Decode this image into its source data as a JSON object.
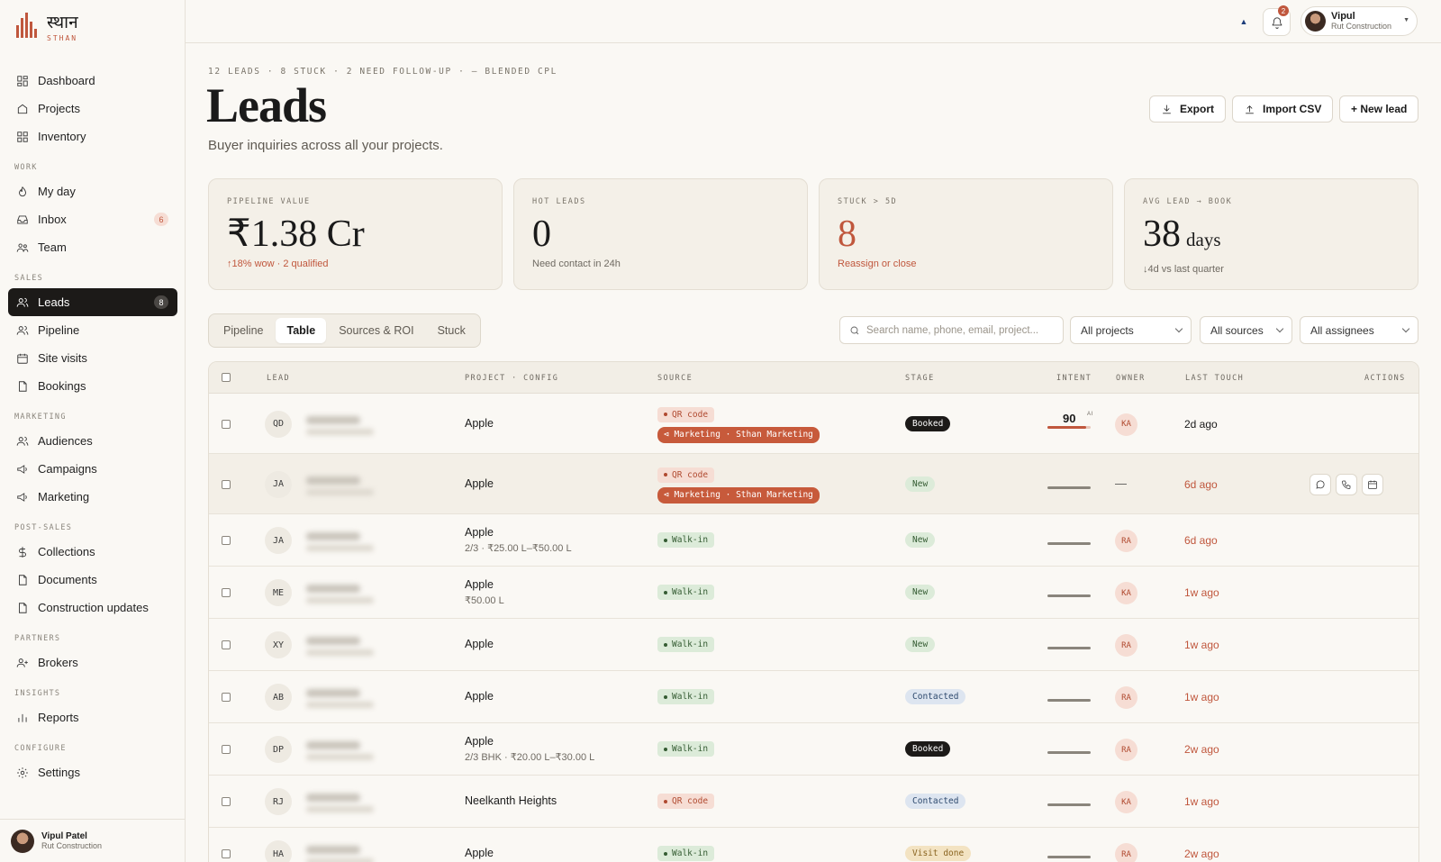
{
  "brand": {
    "name": "स्थान",
    "sub": "STHAN"
  },
  "nav": {
    "top": [
      {
        "id": "dashboard",
        "label": "Dashboard",
        "icon": "dashboard-icon"
      },
      {
        "id": "projects",
        "label": "Projects",
        "icon": "home-icon"
      },
      {
        "id": "inventory",
        "label": "Inventory",
        "icon": "grid-icon"
      }
    ],
    "sections": [
      {
        "title": "WORK",
        "items": [
          {
            "id": "my-day",
            "label": "My day",
            "icon": "flame-icon"
          },
          {
            "id": "inbox",
            "label": "Inbox",
            "icon": "inbox-icon",
            "badge": "6"
          },
          {
            "id": "team",
            "label": "Team",
            "icon": "team-icon"
          }
        ]
      },
      {
        "title": "SALES",
        "items": [
          {
            "id": "leads",
            "label": "Leads",
            "icon": "users-icon",
            "badge": "8",
            "active": true
          },
          {
            "id": "pipeline",
            "label": "Pipeline",
            "icon": "users-icon"
          },
          {
            "id": "site-visits",
            "label": "Site visits",
            "icon": "calendar-icon"
          },
          {
            "id": "bookings",
            "label": "Bookings",
            "icon": "document-icon"
          }
        ]
      },
      {
        "title": "MARKETING",
        "items": [
          {
            "id": "audiences",
            "label": "Audiences",
            "icon": "users-icon"
          },
          {
            "id": "campaigns",
            "label": "Campaigns",
            "icon": "megaphone-icon"
          },
          {
            "id": "marketing",
            "label": "Marketing",
            "icon": "megaphone-icon"
          }
        ]
      },
      {
        "title": "POST-SALES",
        "items": [
          {
            "id": "collections",
            "label": "Collections",
            "icon": "dollar-icon"
          },
          {
            "id": "documents",
            "label": "Documents",
            "icon": "document-icon"
          },
          {
            "id": "construction-updates",
            "label": "Construction updates",
            "icon": "document-icon"
          }
        ]
      },
      {
        "title": "PARTNERS",
        "items": [
          {
            "id": "brokers",
            "label": "Brokers",
            "icon": "user-plus-icon"
          }
        ]
      },
      {
        "title": "INSIGHTS",
        "items": [
          {
            "id": "reports",
            "label": "Reports",
            "icon": "bar-chart-icon"
          }
        ]
      },
      {
        "title": "CONFIGURE",
        "items": [
          {
            "id": "settings",
            "label": "Settings",
            "icon": "gear-icon"
          }
        ]
      }
    ]
  },
  "sidebar_user": {
    "name": "Vipul Patel",
    "org": "Rut Construction"
  },
  "topbar": {
    "notifications": "2",
    "user_name": "Vipul",
    "user_org": "Rut Construction"
  },
  "page": {
    "meta": "12 LEADS · 8 STUCK · 2 NEED FOLLOW-UP · — BLENDED CPL",
    "title": "Leads",
    "subtitle": "Buyer inquiries across all your projects.",
    "buttons": {
      "export": "Export",
      "import": "Import CSV",
      "new": "+ New lead"
    }
  },
  "kpis": [
    {
      "label": "PIPELINE VALUE",
      "value": "₹1.38 Cr",
      "unit": "",
      "note": "↑18% wow · 2 qualified",
      "value_red": false,
      "note_red": true
    },
    {
      "label": "HOT LEADS",
      "value": "0",
      "unit": "",
      "note": "Need contact in 24h",
      "value_red": false,
      "note_red": false
    },
    {
      "label": "STUCK > 5D",
      "value": "8",
      "unit": "",
      "note": "Reassign or close",
      "value_red": true,
      "note_red": true
    },
    {
      "label": "AVG LEAD → BOOK",
      "value": "38",
      "unit": "days",
      "note": "↓4d vs last quarter",
      "value_red": false,
      "note_red": false
    }
  ],
  "tabs": [
    "Pipeline",
    "Table",
    "Sources & ROI",
    "Stuck"
  ],
  "active_tab": "Table",
  "filters": {
    "search_placeholder": "Search name, phone, email, project...",
    "projects": "All projects",
    "sources": "All sources",
    "assignees": "All assignees"
  },
  "table": {
    "columns": [
      "LEAD",
      "PROJECT · CONFIG",
      "SOURCE",
      "STAGE",
      "INTENT",
      "OWNER",
      "LAST TOUCH",
      "ACTIONS"
    ],
    "rows": [
      {
        "initials": "QD",
        "project": "Apple",
        "config": "",
        "sources": [
          "QR code",
          "Marketing · Sthan Marketing"
        ],
        "stage": "Booked",
        "intent": 90,
        "intent_label": "90",
        "intent_ai": "AI",
        "owner": "KA",
        "touch": "2d ago",
        "touch_red": false
      },
      {
        "initials": "JA",
        "project": "Apple",
        "config": "",
        "sources": [
          "QR code",
          "Marketing · Sthan Marketing"
        ],
        "stage": "New",
        "intent": 0,
        "owner": "—",
        "touch": "6d ago",
        "touch_red": true,
        "actions": true
      },
      {
        "initials": "JA",
        "project": "Apple",
        "config": "2/3 · ₹25.00 L–₹50.00 L",
        "sources": [
          "Walk-in"
        ],
        "stage": "New",
        "intent": 0,
        "owner": "RA",
        "touch": "6d ago",
        "touch_red": true
      },
      {
        "initials": "ME",
        "project": "Apple",
        "config": "₹50.00 L",
        "sources": [
          "Walk-in"
        ],
        "stage": "New",
        "intent": 0,
        "owner": "KA",
        "touch": "1w ago",
        "touch_red": true
      },
      {
        "initials": "XY",
        "project": "Apple",
        "config": "",
        "sources": [
          "Walk-in"
        ],
        "stage": "New",
        "intent": 0,
        "owner": "RA",
        "touch": "1w ago",
        "touch_red": true
      },
      {
        "initials": "AB",
        "project": "Apple",
        "config": "",
        "sources": [
          "Walk-in"
        ],
        "stage": "Contacted",
        "intent": 0,
        "owner": "RA",
        "touch": "1w ago",
        "touch_red": true
      },
      {
        "initials": "DP",
        "project": "Apple",
        "config": "2/3 BHK · ₹20.00 L–₹30.00 L",
        "sources": [
          "Walk-in"
        ],
        "stage": "Booked",
        "intent": 0,
        "owner": "RA",
        "touch": "2w ago",
        "touch_red": true
      },
      {
        "initials": "RJ",
        "project": "Neelkanth Heights",
        "config": "",
        "sources": [
          "QR code"
        ],
        "stage": "Contacted",
        "intent": 0,
        "owner": "KA",
        "touch": "1w ago",
        "touch_red": true
      },
      {
        "initials": "HA",
        "project": "Apple",
        "config": "",
        "sources": [
          "Walk-in"
        ],
        "stage": "Visit done",
        "intent": 0,
        "owner": "RA",
        "touch": "2w ago",
        "touch_red": true
      }
    ]
  },
  "colors": {
    "accent": "#c0573d",
    "dark": "#1c1a18",
    "bg": "#faf8f4"
  }
}
